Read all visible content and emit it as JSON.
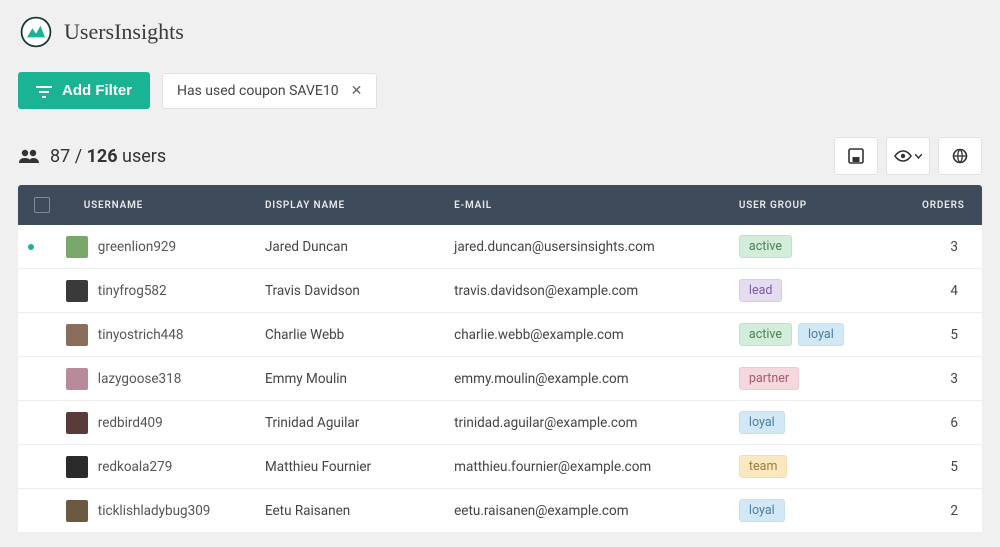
{
  "brand": "UsersInsights",
  "toolbar": {
    "add_filter": "Add Filter",
    "chip_text": "Has used coupon SAVE10"
  },
  "count": {
    "filtered": "87",
    "sep": " / ",
    "total": "126",
    "label": " users"
  },
  "columns": {
    "username": "USERNAME",
    "display": "DISPLAY NAME",
    "email": "E-MAIL",
    "group": "USER GROUP",
    "orders": "ORDERS"
  },
  "rows": [
    {
      "avatar": "#7aa86a",
      "online": true,
      "username": "greenlion929",
      "display": "Jared Duncan",
      "email": "jared.duncan@usersinsights.com",
      "groups": [
        "active"
      ],
      "orders": "3"
    },
    {
      "avatar": "#3a3a3a",
      "online": false,
      "username": "tinyfrog582",
      "display": "Travis Davidson",
      "email": "travis.davidson@example.com",
      "groups": [
        "lead"
      ],
      "orders": "4"
    },
    {
      "avatar": "#8a6d5a",
      "online": false,
      "username": "tinyostrich448",
      "display": "Charlie Webb",
      "email": "charlie.webb@example.com",
      "groups": [
        "active",
        "loyal"
      ],
      "orders": "5"
    },
    {
      "avatar": "#b88a9a",
      "online": false,
      "username": "lazygoose318",
      "display": "Emmy Moulin",
      "email": "emmy.moulin@example.com",
      "groups": [
        "partner"
      ],
      "orders": "3"
    },
    {
      "avatar": "#5a3a3a",
      "online": false,
      "username": "redbird409",
      "display": "Trinidad Aguilar",
      "email": "trinidad.aguilar@example.com",
      "groups": [
        "loyal"
      ],
      "orders": "6"
    },
    {
      "avatar": "#2b2b2b",
      "online": false,
      "username": "redkoala279",
      "display": "Matthieu Fournier",
      "email": "matthieu.fournier@example.com",
      "groups": [
        "team"
      ],
      "orders": "5"
    },
    {
      "avatar": "#6b5942",
      "online": false,
      "username": "ticklishladybug309",
      "display": "Eetu Raisanen",
      "email": "eetu.raisanen@example.com",
      "groups": [
        "loyal"
      ],
      "orders": "2"
    }
  ]
}
